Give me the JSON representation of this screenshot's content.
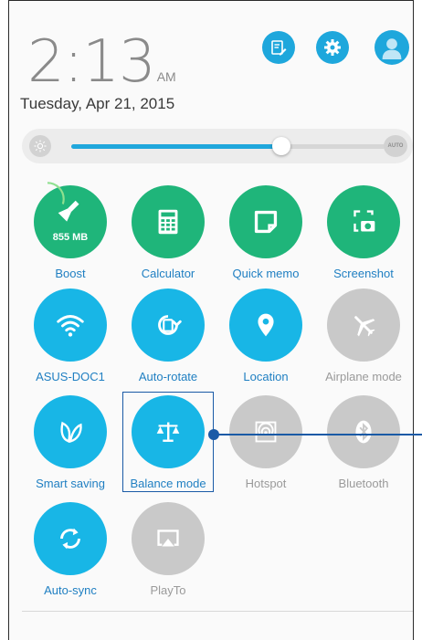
{
  "clock": {
    "time": "2:13",
    "ampm": "AM",
    "date": "Tuesday, Apr 21, 2015"
  },
  "brightness": {
    "level": 0.67,
    "auto_icon": "sun-auto-icon",
    "mode_label": "AUTO"
  },
  "top_buttons": [
    {
      "name": "edit-quick-settings-icon"
    },
    {
      "name": "settings-gear-icon"
    },
    {
      "name": "user-avatar-icon"
    }
  ],
  "tiles": {
    "boost": {
      "label": "Boost",
      "value": "855 MB",
      "usage_fraction": 0.3
    },
    "calculator": {
      "label": "Calculator"
    },
    "quick_memo": {
      "label": "Quick memo"
    },
    "screenshot": {
      "label": "Screenshot"
    },
    "wifi": {
      "label": "ASUS-DOC1"
    },
    "auto_rotate": {
      "label": "Auto-rotate"
    },
    "location": {
      "label": "Location"
    },
    "airplane": {
      "label": "Airplane mode"
    },
    "smart_saving": {
      "label": "Smart saving"
    },
    "balance_mode": {
      "label": "Balance mode"
    },
    "hotspot": {
      "label": "Hotspot"
    },
    "bluetooth": {
      "label": "Bluetooth"
    },
    "auto_sync": {
      "label": "Auto-sync"
    },
    "playto": {
      "label": "PlayTo"
    }
  },
  "colors": {
    "green": "#1fb57a",
    "blue": "#18b6e6",
    "gray": "#c9c9c9",
    "accent": "#1a5aa6"
  }
}
